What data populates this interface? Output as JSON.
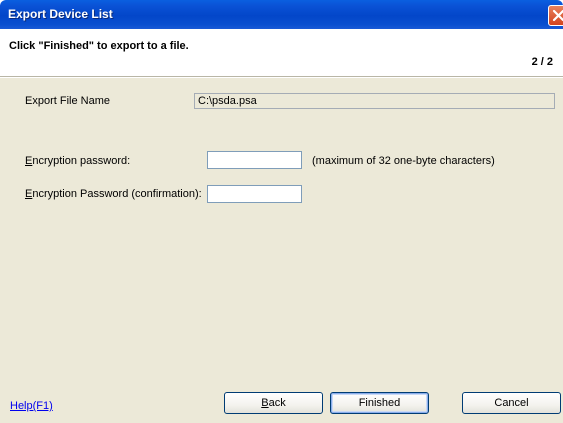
{
  "window": {
    "title": "Export Device List",
    "close_icon": "close-icon"
  },
  "header": {
    "instruction": "Click \"Finished\" to export to a file.",
    "step": "2 / 2"
  },
  "form": {
    "export_file_label": "Export File Name",
    "export_file_value": "C:\\psda.psa",
    "password_label_access": "E",
    "password_label_rest": "ncryption password:",
    "password_hint": "(maximum of 32 one-byte characters)",
    "confirm_label_access": "E",
    "confirm_label_rest": "ncryption Password (confirmation):",
    "password_value": "",
    "confirm_value": ""
  },
  "footer": {
    "help_link": "Help(F1)",
    "back_access": "B",
    "back_rest": "ack",
    "finished_label": "Finished",
    "cancel_label": "Cancel"
  },
  "colors": {
    "titlebar": "#0346c9",
    "dialog_bg": "#ece9d8",
    "close_button": "#d3431e"
  }
}
